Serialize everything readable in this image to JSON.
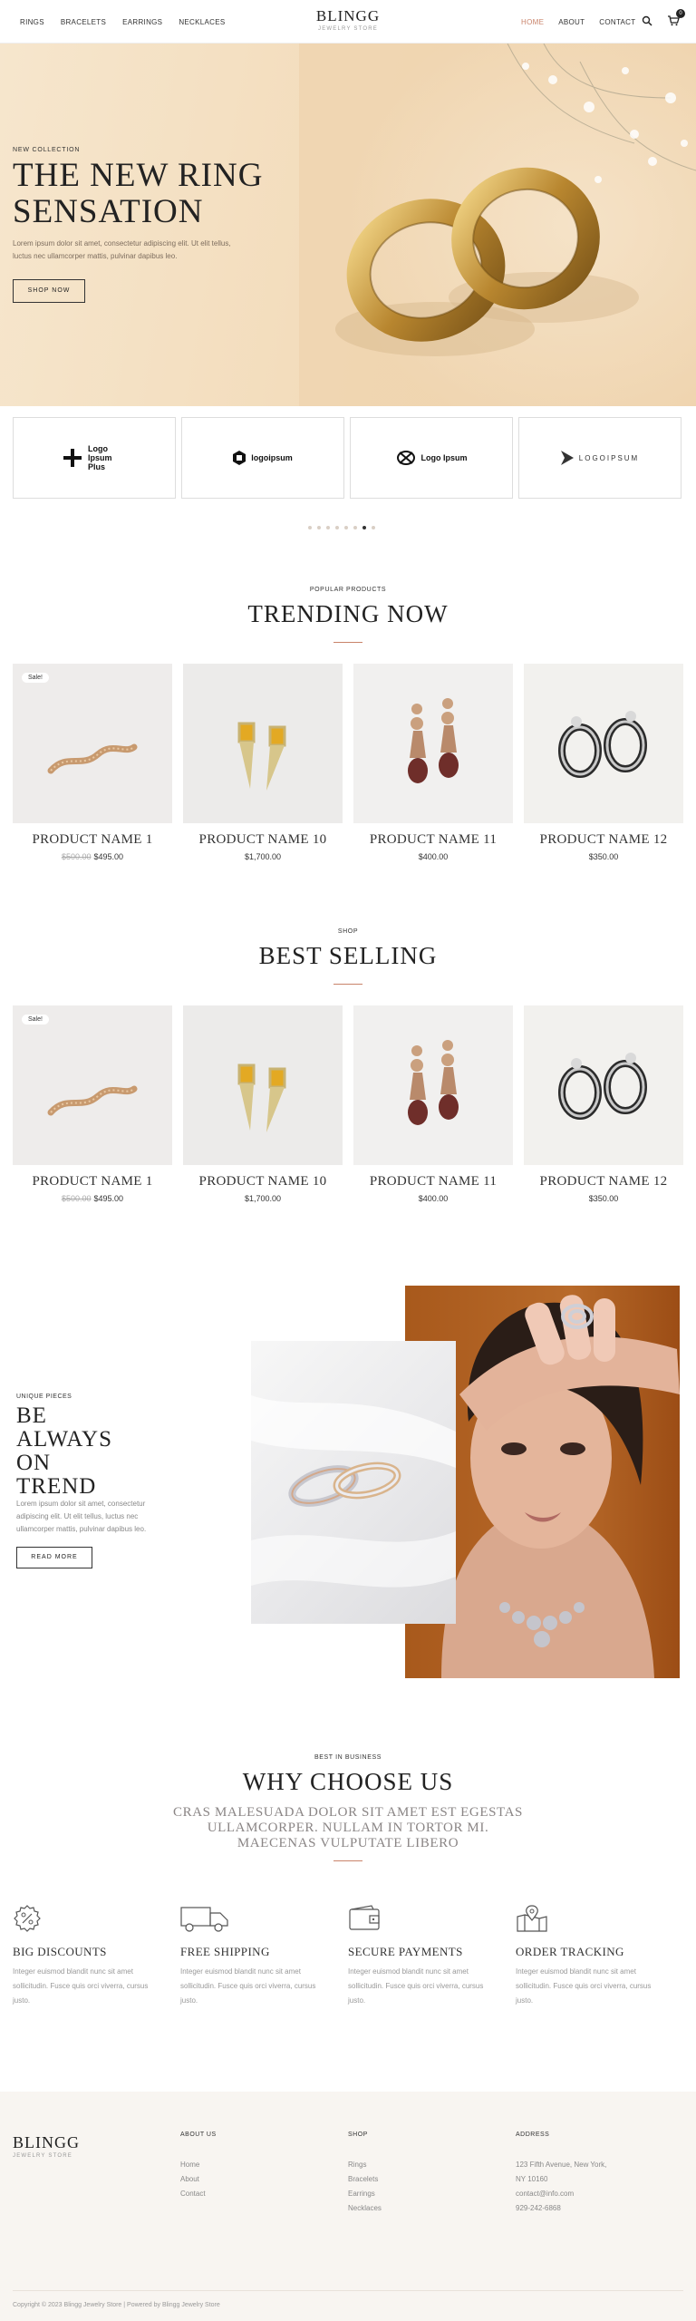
{
  "colors": {
    "accent": "#c9836a",
    "text": "#333333",
    "footer_bg": "#f8f5f1",
    "hero_bg": "#f3ddbd"
  },
  "header": {
    "nav_left": [
      "RINGS",
      "BRACELETS",
      "EARRINGS",
      "NECKLACES"
    ],
    "brand": "BLINGG",
    "brand_sub": "JEWELRY STORE",
    "nav_right": [
      "HOME",
      "ABOUT",
      "CONTACT"
    ],
    "active_item": "HOME",
    "cart_count": "0",
    "icons": [
      "search-icon",
      "cart-icon"
    ]
  },
  "hero": {
    "eyebrow": "NEW COLLECTION",
    "title_line1": "THE NEW RING",
    "title_line2": "SENSATION",
    "text": "Lorem ipsum dolor sit amet, consectetur adipiscing elit. Ut elit tellus, luctus nec ullamcorper mattis, pulvinar dapibus leo.",
    "button": "SHOP NOW"
  },
  "logos": [
    {
      "text": "Logo Ipsum Plus",
      "icon": "cross-logo-icon"
    },
    {
      "text": "logoipsum",
      "icon": "hex-logo-icon"
    },
    {
      "text": "Logo Ipsum",
      "icon": "knot-logo-icon"
    },
    {
      "text": "LOGOIPSUM",
      "icon": "arrow-logo-icon"
    }
  ],
  "slider": {
    "total": 8,
    "active": 6
  },
  "trending": {
    "eyebrow": "POPULAR PRODUCTS",
    "title": "TRENDING NOW",
    "products": [
      {
        "name": "PRODUCT NAME 1",
        "old_price": "$500.00",
        "price": "$495.00",
        "badge": "Sale!"
      },
      {
        "name": "PRODUCT NAME 10",
        "old_price": "",
        "price": "$1,700.00",
        "badge": ""
      },
      {
        "name": "PRODUCT NAME 11",
        "old_price": "",
        "price": "$400.00",
        "badge": ""
      },
      {
        "name": "PRODUCT NAME 12",
        "old_price": "",
        "price": "$350.00",
        "badge": ""
      }
    ]
  },
  "best": {
    "eyebrow": "SHOP",
    "title": "BEST SELLING",
    "products": [
      {
        "name": "PRODUCT NAME 1",
        "old_price": "$500.00",
        "price": "$495.00",
        "badge": "Sale!"
      },
      {
        "name": "PRODUCT NAME 10",
        "old_price": "",
        "price": "$1,700.00",
        "badge": ""
      },
      {
        "name": "PRODUCT NAME 11",
        "old_price": "",
        "price": "$400.00",
        "badge": ""
      },
      {
        "name": "PRODUCT NAME 12",
        "old_price": "",
        "price": "$350.00",
        "badge": ""
      }
    ]
  },
  "trend": {
    "eyebrow": "UNIQUE PIECES",
    "title_lines": [
      "BE",
      "ALWAYS",
      "ON",
      "TREND"
    ],
    "text": "Lorem ipsum dolor sit amet, consectetur adipiscing elit. Ut elit tellus, luctus nec ullamcorper mattis, pulvinar dapibus leo.",
    "button": "READ MORE"
  },
  "why": {
    "eyebrow": "BEST IN BUSINESS",
    "title": "WHY CHOOSE US",
    "subtitle_lines": [
      "CRAS MALESUADA DOLOR SIT AMET EST EGESTAS",
      "ULLAMCORPER. NULLAM IN TORTOR MI.",
      "MAECENAS VULPUTATE LIBERO"
    ],
    "features": [
      {
        "icon": "discount-icon",
        "title": "BIG DISCOUNTS",
        "text": "Integer euismod blandit nunc sit amet sollicitudin. Fusce quis orci viverra, cursus justo."
      },
      {
        "icon": "truck-icon",
        "title": "FREE SHIPPING",
        "text": "Integer euismod blandit nunc sit amet sollicitudin. Fusce quis orci viverra, cursus justo."
      },
      {
        "icon": "wallet-icon",
        "title": "SECURE PAYMENTS",
        "text": "Integer euismod blandit nunc sit amet sollicitudin. Fusce quis orci viverra, cursus justo."
      },
      {
        "icon": "map-pin-icon",
        "title": "ORDER TRACKING",
        "text": "Integer euismod blandit nunc sit amet sollicitudin. Fusce quis orci viverra, cursus justo."
      }
    ]
  },
  "footer": {
    "brand": "BLINGG",
    "brand_sub": "JEWELRY STORE",
    "about_head": "ABOUT US",
    "about_links": [
      "Home",
      "About",
      "Contact"
    ],
    "shop_head": "SHOP",
    "shop_links": [
      "Rings",
      "Bracelets",
      "Earrings",
      "Necklaces"
    ],
    "address_head": "ADDRESS",
    "address_lines": [
      "123 Fifth Avenue, New York,",
      "NY 10160",
      "contact@info.com",
      "929-242-6868"
    ],
    "copyright": "Copyright © 2023 Blingg Jewelry Store | Powered by Blingg Jewelry Store"
  }
}
